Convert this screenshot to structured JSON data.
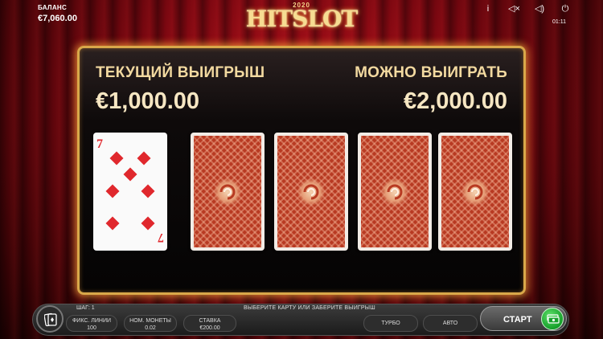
{
  "balance": {
    "label": "БАЛАНС",
    "value": "€7,060.00"
  },
  "logo": {
    "year": "2020",
    "text": "HITSLOT"
  },
  "top_icons": [
    "info-icon",
    "mute-icon",
    "sound-icon",
    "power-icon"
  ],
  "top_icon_glyphs": {
    "info": "i",
    "mute": "◁×",
    "sound": "◁)",
    "power": "⏻"
  },
  "clock": "01:11",
  "board": {
    "current_win_label": "ТЕКУЩИЙ ВЫИГРЫШ",
    "current_win_value": "€1,000.00",
    "possible_win_label": "МОЖНО ВЫИГРАТЬ",
    "possible_win_value": "€2,000.00"
  },
  "cards": {
    "face": {
      "rank": "7",
      "suit": "diamonds"
    },
    "backs": 4
  },
  "bottom": {
    "step_label": "ШАГ: 1",
    "message": "ВЫБЕРИТЕ КАРТУ ИЛИ ЗАБЕРИТЕ ВЫИГРЫШ",
    "lines_label": "ФИКС. ЛИНИИ",
    "lines_value": "100",
    "coin_label": "НОМ. МОНЕТЫ",
    "coin_value": "0.02",
    "bet_label": "СТАВКА",
    "bet_value": "€200.00",
    "turbo_label": "ТУРБО",
    "auto_label": "АВТО",
    "start_label": "СТАРТ"
  },
  "colors": {
    "accent_gold": "#d9a84a",
    "card_red": "#e0282d",
    "start_green": "#16a02a"
  }
}
